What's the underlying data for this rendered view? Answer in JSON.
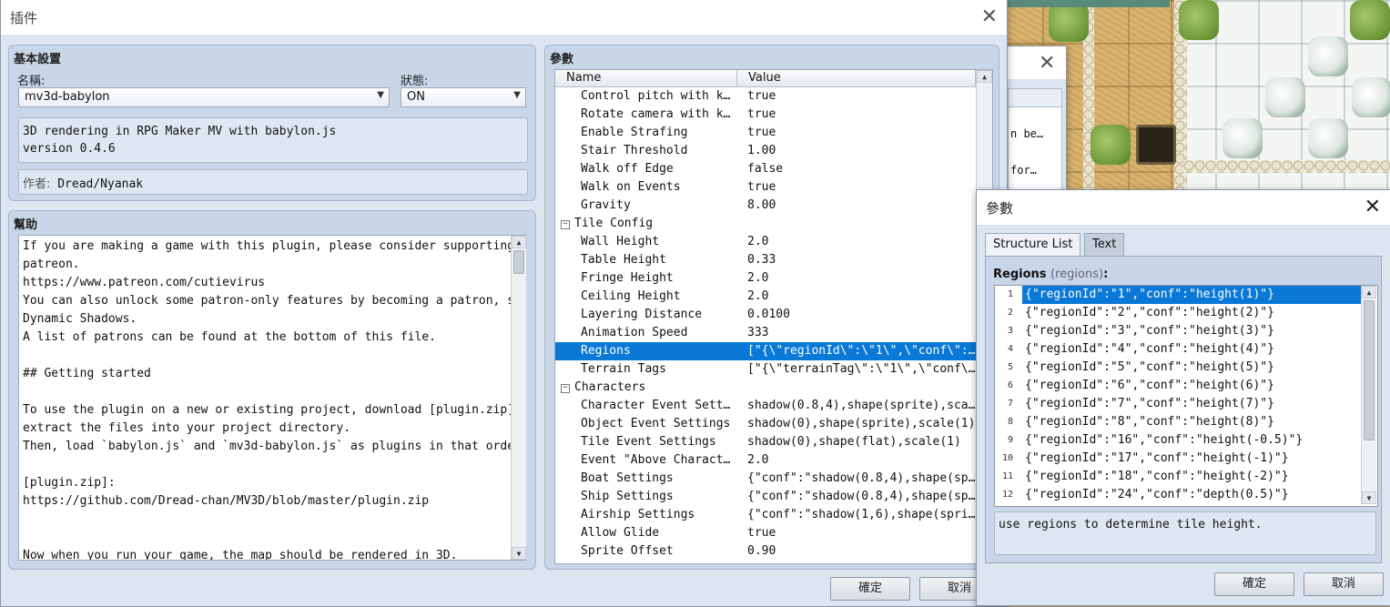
{
  "plugin_window": {
    "title": "插件",
    "basic": {
      "header": "基本設置",
      "name_label": "名稱:",
      "name_value": "mv3d-babylon",
      "status_label": "狀態:",
      "status_value": "ON",
      "description_lines": [
        "3D rendering in RPG Maker MV with babylon.js",
        "version 0.4.6"
      ],
      "author_label": "作者:",
      "author_value": "Dread/Nyanak"
    },
    "help": {
      "header": "幫助",
      "lines": [
        "If you are making a game with this plugin, please consider supporting my",
        "patreon.",
        "https://www.patreon.com/cutievirus",
        "You can also unlock some patron-only features by becoming a patron, such as",
        "Dynamic Shadows.",
        "A list of patrons can be found at the bottom of this file.",
        "",
        "## Getting started",
        "",
        "To use the plugin on a new or existing project, download [plugin.zip] and",
        "extract the files into your project directory.",
        "Then, load `babylon.js` and `mv3d-babylon.js` as plugins in that order.",
        "",
        "[plugin.zip]:",
        "https://github.com/Dread-chan/MV3D/blob/master/plugin.zip",
        "",
        "",
        "Now when you run your game, the map should be rendered in 3D."
      ]
    },
    "params": {
      "header": "參數",
      "col_name": "Name",
      "col_value": "Value",
      "rows": [
        {
          "kind": "item",
          "name": "Control pitch with keyb…",
          "value": "true"
        },
        {
          "kind": "item",
          "name": "Rotate camera with keyb…",
          "value": "true"
        },
        {
          "kind": "item",
          "name": "Enable Strafing",
          "value": "true"
        },
        {
          "kind": "item",
          "name": "Stair Threshold",
          "value": "1.00"
        },
        {
          "kind": "item",
          "name": "Walk off Edge",
          "value": "false"
        },
        {
          "kind": "item",
          "name": "Walk on Events",
          "value": "true"
        },
        {
          "kind": "item",
          "name": "Gravity",
          "value": "8.00"
        },
        {
          "kind": "cat",
          "name": "Tile Config",
          "value": ""
        },
        {
          "kind": "item",
          "name": "Wall Height",
          "value": "2.0"
        },
        {
          "kind": "item",
          "name": "Table Height",
          "value": "0.33"
        },
        {
          "kind": "item",
          "name": "Fringe Height",
          "value": "2.0"
        },
        {
          "kind": "item",
          "name": "Ceiling Height",
          "value": "2.0"
        },
        {
          "kind": "item",
          "name": "Layering Distance",
          "value": "0.0100"
        },
        {
          "kind": "item",
          "name": "Animation Speed",
          "value": "333"
        },
        {
          "kind": "item",
          "name": "Regions",
          "value": "[\"{\\\"regionId\\\":\\\"1\\\",\\\"conf\\\":\\\"h…",
          "selected": true
        },
        {
          "kind": "item",
          "name": "Terrain Tags",
          "value": "[\"{\\\"terrainTag\\\":\\\"1\\\",\\\"conf\\\":\\…"
        },
        {
          "kind": "cat",
          "name": "Characters",
          "value": ""
        },
        {
          "kind": "item",
          "name": "Character Event Settings",
          "value": "shadow(0.8,4),shape(sprite),scale(1)"
        },
        {
          "kind": "item",
          "name": "Object Event Settings",
          "value": "shadow(0),shape(sprite),scale(1)"
        },
        {
          "kind": "item",
          "name": "Tile Event Settings",
          "value": "shadow(0),shape(flat),scale(1)"
        },
        {
          "kind": "item",
          "name": "Event \"Above Characters…",
          "value": "2.0"
        },
        {
          "kind": "item",
          "name": "Boat Settings",
          "value": "{\"conf\":\"shadow(0.8,4),shape(sprit…"
        },
        {
          "kind": "item",
          "name": "Ship Settings",
          "value": "{\"conf\":\"shadow(0.8,4),shape(sprit…"
        },
        {
          "kind": "item",
          "name": "Airship Settings",
          "value": "{\"conf\":\"shadow(1,6),shape(sprite)…"
        },
        {
          "kind": "item",
          "name": "Allow Glide",
          "value": "true"
        },
        {
          "kind": "item",
          "name": "Sprite Offset",
          "value": "0.90"
        }
      ]
    },
    "ok_label": "確定",
    "cancel_label": "取消"
  },
  "middle_window": {
    "snippets": [
      "n be…",
      "for…"
    ]
  },
  "param_dialog": {
    "title": "參數",
    "tab_structure": "Structure List",
    "tab_text": "Text",
    "regions_label": "Regions",
    "regions_hint": "(regions)",
    "regions_colon": ":",
    "list": [
      {
        "num": "1",
        "text": "{\"regionId\":\"1\",\"conf\":\"height(1)\"}"
      },
      {
        "num": "2",
        "text": "{\"regionId\":\"2\",\"conf\":\"height(2)\"}"
      },
      {
        "num": "3",
        "text": "{\"regionId\":\"3\",\"conf\":\"height(3)\"}"
      },
      {
        "num": "4",
        "text": "{\"regionId\":\"4\",\"conf\":\"height(4)\"}"
      },
      {
        "num": "5",
        "text": "{\"regionId\":\"5\",\"conf\":\"height(5)\"}"
      },
      {
        "num": "6",
        "text": "{\"regionId\":\"6\",\"conf\":\"height(6)\"}"
      },
      {
        "num": "7",
        "text": "{\"regionId\":\"7\",\"conf\":\"height(7)\"}"
      },
      {
        "num": "8",
        "text": "{\"regionId\":\"8\",\"conf\":\"height(8)\"}"
      },
      {
        "num": "9",
        "text": "{\"regionId\":\"16\",\"conf\":\"height(-0.5)\"}"
      },
      {
        "num": "10",
        "text": "{\"regionId\":\"17\",\"conf\":\"height(-1)\"}"
      },
      {
        "num": "11",
        "text": "{\"regionId\":\"18\",\"conf\":\"height(-2)\"}"
      },
      {
        "num": "12",
        "text": "{\"regionId\":\"24\",\"conf\":\"depth(0.5)\"}"
      }
    ],
    "description": "use regions to determine tile height.",
    "ok_label": "確定",
    "cancel_label": "取消"
  },
  "colors": {
    "selection": "#0a78d7",
    "window_bg": "#dde6f0",
    "group_bg": "#c8d6e8"
  }
}
